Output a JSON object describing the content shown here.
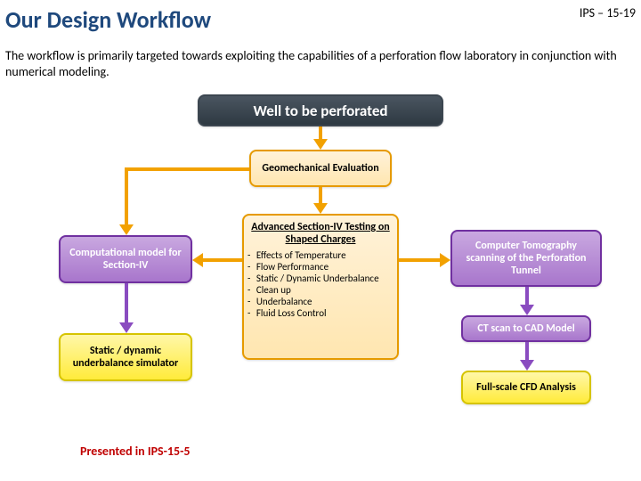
{
  "title": "Our Design Workflow",
  "header_code": "IPS – 15-19",
  "intro": "The workflow is primarily targeted towards exploiting the capabilities of a perforation flow laboratory in conjunction with numerical modeling.",
  "top_box": "Well to be perforated",
  "geo_box": "Geomechanical Evaluation",
  "center": {
    "title": "Advanced Section-IV Testing on Shaped Charges",
    "items": [
      "Effects of Temperature",
      "Flow Performance",
      "Static / Dynamic Underbalance",
      "Clean up",
      "Underbalance",
      "Fluid Loss Control"
    ]
  },
  "left_comp": "Computational model for Section-IV",
  "left_sim": "Static / dynamic underbalance simulator",
  "right_ct": "Computer Tomography scanning of the Perforation Tunnel",
  "right_cad": "CT scan to CAD Model",
  "right_cfd": "Full-scale CFD Analysis",
  "credit": "Presented in IPS-15-5"
}
